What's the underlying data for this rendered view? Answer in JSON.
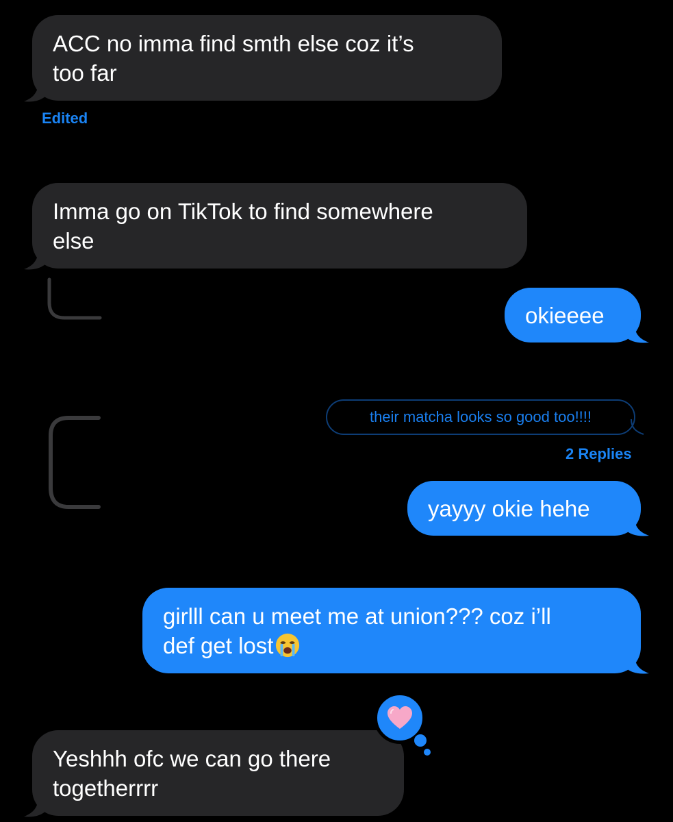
{
  "conversation": {
    "messages": [
      {
        "id": "m1",
        "direction": "received",
        "text": "ACC no imma find smth else coz it’s\ntoo far",
        "meta": "Edited"
      },
      {
        "id": "m2",
        "direction": "received",
        "text": "Imma go on TikTok to find somewhere\nelse"
      },
      {
        "id": "m3",
        "direction": "sent",
        "text": "okieeee"
      },
      {
        "id": "m4",
        "direction": "sent",
        "quoted_reply": "their matcha looks so good too!!!!",
        "thread_meta": "2 Replies",
        "text": "yayyy okie hehe"
      },
      {
        "id": "m5",
        "direction": "sent",
        "text_line1": "girlll can u meet me at union??? coz i’ll",
        "text_line2": "def get lost",
        "emoji": "loudly-crying-face"
      },
      {
        "id": "m6",
        "direction": "received",
        "text": "Yeshhh ofc we can go there\ntogetherrrr",
        "tapback": "pink-heart"
      }
    ]
  },
  "colors": {
    "background": "#000000",
    "received_bubble": "#262628",
    "sent_bubble": "#1f87fa",
    "accent_text": "#1a84f5"
  }
}
